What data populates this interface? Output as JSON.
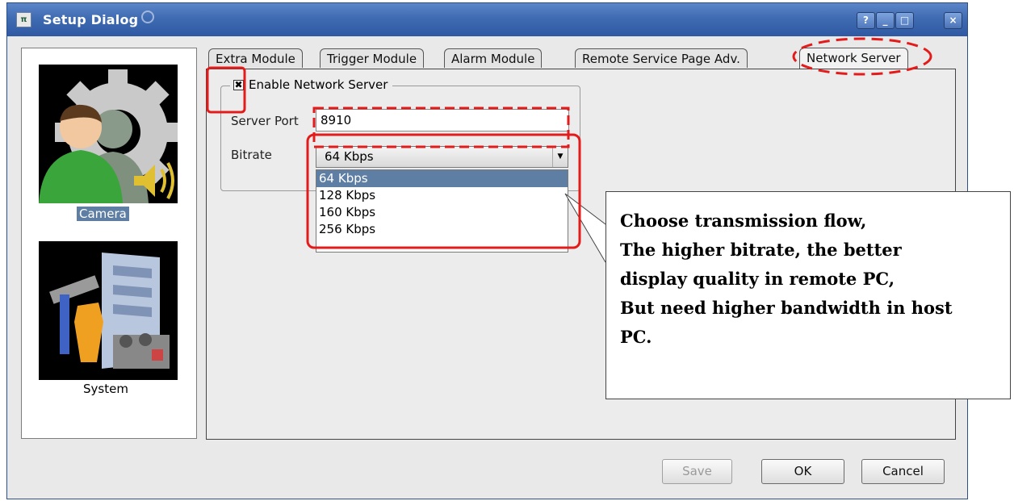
{
  "window": {
    "title": "Setup Dialog",
    "controls": {
      "help": "?",
      "minimize": "_",
      "maximize": "□",
      "close": "×"
    }
  },
  "sidebar": {
    "items": [
      {
        "label": "Camera",
        "icon": "camera-settings-icon",
        "selected": true
      },
      {
        "label": "System",
        "icon": "system-tools-icon",
        "selected": false
      }
    ]
  },
  "tabs": [
    {
      "label": "Extra Module",
      "active": false
    },
    {
      "label": "Trigger Module",
      "active": false
    },
    {
      "label": "Alarm Module",
      "active": false
    },
    {
      "label": "Remote Service Page Adv.",
      "active": false
    },
    {
      "label": "Network Server",
      "active": true
    }
  ],
  "network_server": {
    "enable_label": "Enable Network Server",
    "enabled": true,
    "check_mark": "✖",
    "server_port_label": "Server Port",
    "server_port_value": "8910",
    "bitrate_label": "Bitrate",
    "bitrate_selected": "64 Kbps",
    "bitrate_options": [
      "64 Kbps",
      "128 Kbps",
      "160 Kbps",
      "256 Kbps"
    ]
  },
  "buttons": {
    "save": "Save",
    "ok": "OK",
    "cancel": "Cancel"
  },
  "callout": {
    "lines": [
      "Choose transmission flow,",
      "The higher bitrate, the better",
      "display quality in remote PC,",
      "But need higher bandwidth in host",
      "PC."
    ]
  },
  "colors": {
    "annotation": "#e31b1b",
    "selection": "#5e7fa3",
    "titlebar": "#3f6bb3"
  }
}
